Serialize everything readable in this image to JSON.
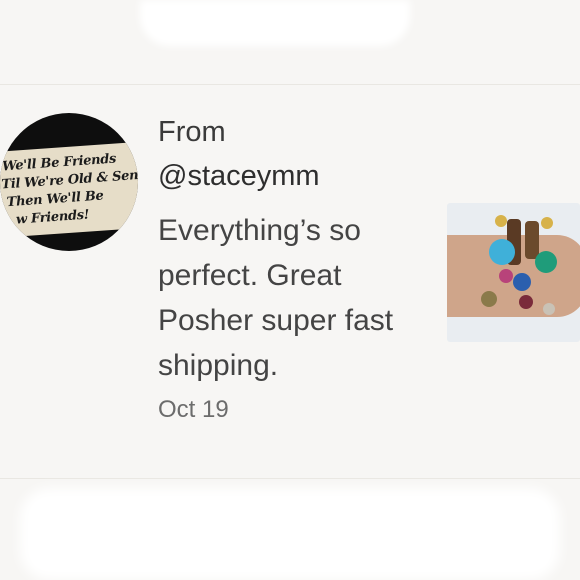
{
  "review": {
    "from_label": "From",
    "username": "@staceymm",
    "message": "Everything’s so perfect. Great Posher super fast shipping.",
    "date": "Oct 19"
  },
  "avatar": {
    "lines": [
      "We'll Be Friends",
      "Til We're Old & Senile",
      "Then We'll Be",
      "w Friends!"
    ]
  },
  "thumbnail": {
    "subject": "beaded bracelets on wrist"
  },
  "colors": {
    "background": "#f7f6f4",
    "text_primary": "#3a3a3a",
    "text_secondary": "#6c6c6c",
    "divider": "#e9e7e2"
  }
}
